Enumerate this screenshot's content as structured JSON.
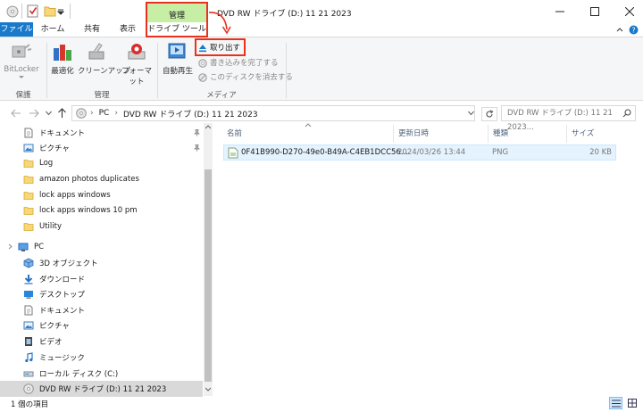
{
  "window": {
    "title": "DVD RW ドライブ (D:) 11 21 2023",
    "contextual_tab_header": "管理",
    "contextual_tab_name": "ドライブ ツール",
    "controls": [
      "minimize",
      "maximize",
      "close"
    ]
  },
  "ribbon": {
    "tabs": [
      "ファイル",
      "ホーム",
      "共有",
      "表示"
    ],
    "groups": [
      {
        "label": "保護",
        "buttons": [
          "BitLocker"
        ]
      },
      {
        "label": "管理",
        "buttons": [
          "最適化",
          "クリーンアップ",
          "フォーマット"
        ]
      },
      {
        "label": "メディア",
        "large_button": "自動再生",
        "small_buttons": [
          "取り出す",
          "書き込みを完了する",
          "このディスクを消去する"
        ]
      }
    ]
  },
  "address": {
    "path": [
      "PC",
      "DVD RW ドライブ (D:) 11 21 2023"
    ],
    "search_placeholder": "DVD RW ドライブ (D:) 11 21 2023..."
  },
  "nav": {
    "items": [
      {
        "label": "ドキュメント",
        "icon": "document-icon",
        "pinned": true
      },
      {
        "label": "ピクチャ",
        "icon": "picture-icon",
        "pinned": true
      },
      {
        "label": "Log",
        "icon": "folder-icon"
      },
      {
        "label": "amazon photos duplicates",
        "icon": "folder-icon"
      },
      {
        "label": "lock apps windows",
        "icon": "folder-icon"
      },
      {
        "label": "lock apps windows 10 pm",
        "icon": "folder-icon"
      },
      {
        "label": "Utility",
        "icon": "folder-icon"
      },
      {
        "label": "PC",
        "icon": "pc-icon"
      },
      {
        "label": "3D オブジェクト",
        "icon": "3d-objects-icon"
      },
      {
        "label": "ダウンロード",
        "icon": "download-icon"
      },
      {
        "label": "デスクトップ",
        "icon": "desktop-icon"
      },
      {
        "label": "ドキュメント",
        "icon": "document-icon"
      },
      {
        "label": "ピクチャ",
        "icon": "picture-icon"
      },
      {
        "label": "ビデオ",
        "icon": "video-icon"
      },
      {
        "label": "ミュージック",
        "icon": "music-icon"
      },
      {
        "label": "ローカル ディスク (C:)",
        "icon": "local-disk-icon"
      },
      {
        "label": "DVD RW ドライブ (D:) 11 21 2023",
        "icon": "dvd-drive-icon",
        "selected": true
      }
    ]
  },
  "files": {
    "columns": [
      "名前",
      "更新日時",
      "種類",
      "サイズ"
    ],
    "rows": [
      {
        "name": "0F41B990-D270-49e0-B49A-C4EB1DCC56...",
        "modified": "2024/03/26 13:44",
        "type": "PNG",
        "size": "20 KB"
      }
    ]
  },
  "status": {
    "text": "1 個の項目"
  },
  "colors": {
    "accent": "#1979ca",
    "contextual_green": "#c6efa5",
    "highlight_red": "#e8321e",
    "selection": "#e5f3ff"
  }
}
